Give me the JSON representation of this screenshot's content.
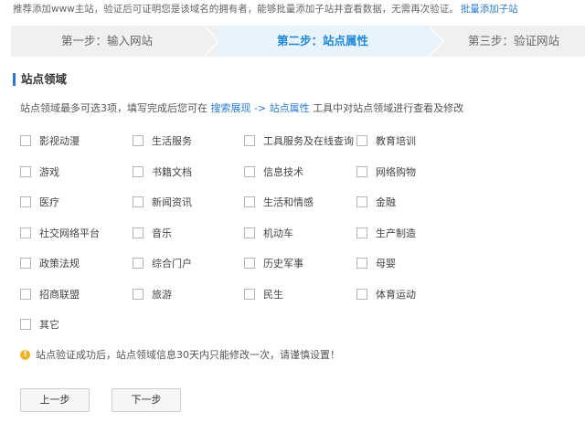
{
  "top_note": {
    "text": "推荐添加www主站，验证后可证明您是该域名的拥有者，能够批量添加子站并查看数据，无需再次验证。",
    "link": "批量添加子站"
  },
  "steps": [
    {
      "label": "第一步：输入网站"
    },
    {
      "label": "第二步：站点属性"
    },
    {
      "label": "第三步：验证网站"
    }
  ],
  "section": {
    "title": "站点领域",
    "desc_prefix": "站点领域最多可选3项，填写完成后您可在",
    "desc_link": "搜索展现 -> 站点属性",
    "desc_suffix": "工具中对站点领域进行查看及修改"
  },
  "options": [
    "影视动漫",
    "生活服务",
    "工具服务及在线查询",
    "教育培训",
    "游戏",
    "书籍文档",
    "信息技术",
    "网络购物",
    "医疗",
    "新闻资讯",
    "生活和情感",
    "金融",
    "社交网络平台",
    "音乐",
    "机动车",
    "生产制造",
    "政策法规",
    "综合门户",
    "历史军事",
    "母婴",
    "招商联盟",
    "旅游",
    "民生",
    "体育运动",
    "其它"
  ],
  "warning": {
    "icon": "warning-icon",
    "text": "站点验证成功后，站点领域信息30天内只能修改一次，请谨慎设置！"
  },
  "buttons": {
    "prev": "上一步",
    "next": "下一步"
  },
  "colors": {
    "accent": "#2b7bd6",
    "active_step_bg": "#e8f3fc",
    "step_bg": "#f0f0f0",
    "warning": "#f0b429"
  }
}
